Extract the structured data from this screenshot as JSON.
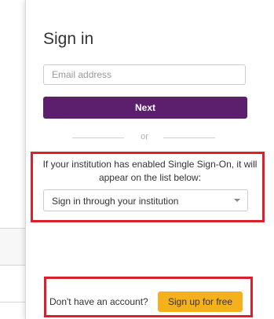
{
  "dialog": {
    "title": "Sign in",
    "email_placeholder": "Email address",
    "next_label": "Next",
    "divider_text": "or",
    "sso_text": "If your institution has enabled Single Sign-On, it will appear on the list below:",
    "institution_select_value": "Sign in through your institution",
    "no_account_text": "Don't have an account?",
    "signup_label": "Sign up for free"
  },
  "colors": {
    "primary_button": "#5c1f6e",
    "signup_button": "#f5b01e",
    "highlight_border": "#d9202b"
  }
}
